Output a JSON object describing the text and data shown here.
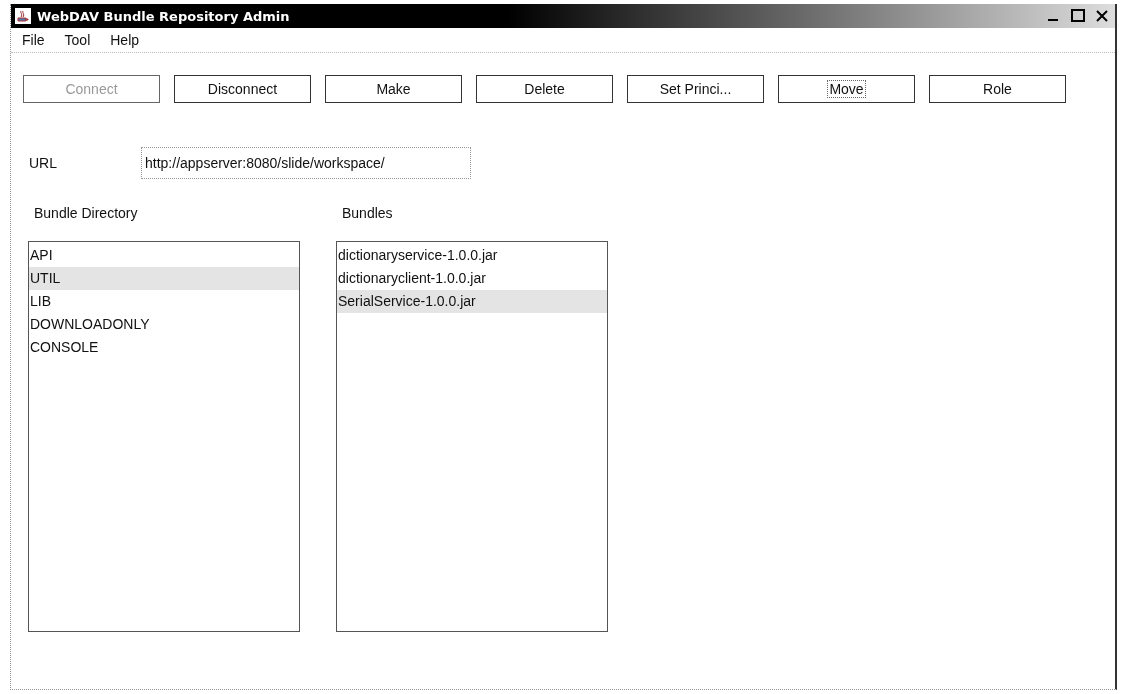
{
  "window": {
    "title": "WebDAV Bundle Repository Admin"
  },
  "menu": [
    "File",
    "Tool",
    "Help"
  ],
  "buttons": [
    {
      "label": "Connect",
      "disabled": true,
      "focused": false
    },
    {
      "label": "Disconnect",
      "disabled": false,
      "focused": false
    },
    {
      "label": "Make",
      "disabled": false,
      "focused": false
    },
    {
      "label": "Delete",
      "disabled": false,
      "focused": false
    },
    {
      "label": "Set Princi...",
      "disabled": false,
      "focused": false
    },
    {
      "label": "Move",
      "disabled": false,
      "focused": true
    },
    {
      "label": "Role",
      "disabled": false,
      "focused": false
    }
  ],
  "url": {
    "label": "URL",
    "value": "http://appserver:8080/slide/workspace/"
  },
  "bundle_directory": {
    "label": "Bundle Directory",
    "items": [
      {
        "label": "API",
        "selected": false
      },
      {
        "label": "UTIL",
        "selected": true
      },
      {
        "label": "LIB",
        "selected": false
      },
      {
        "label": "DOWNLOADONLY",
        "selected": false
      },
      {
        "label": "CONSOLE",
        "selected": false
      }
    ]
  },
  "bundles": {
    "label": "Bundles",
    "items": [
      {
        "label": "dictionaryservice-1.0.0.jar",
        "selected": false
      },
      {
        "label": "dictionaryclient-1.0.0.jar",
        "selected": false
      },
      {
        "label": "SerialService-1.0.0.jar",
        "selected": true
      }
    ]
  }
}
